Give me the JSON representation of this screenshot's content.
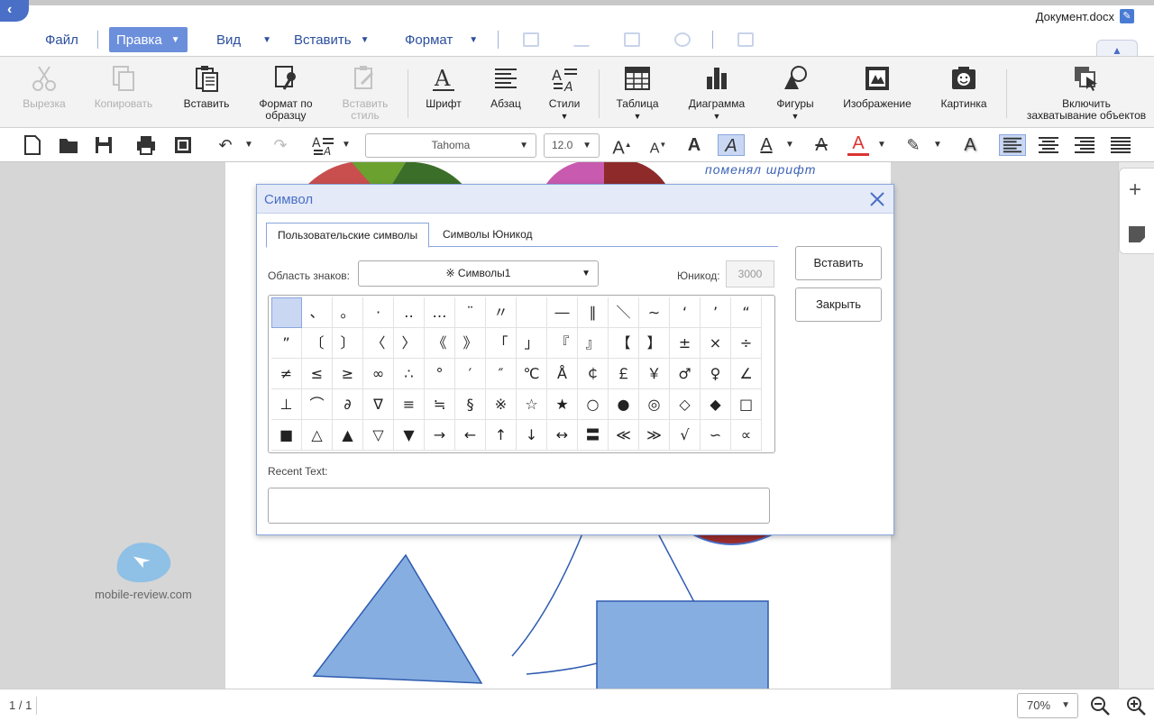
{
  "window": {
    "doc_name": "Документ.docx"
  },
  "menu": {
    "items": [
      {
        "label": "Файл"
      },
      {
        "label": "Правка"
      },
      {
        "label": "Вид"
      },
      {
        "label": "Вставить"
      },
      {
        "label": "Формат"
      }
    ]
  },
  "ribbon": {
    "cut": "Вырезка",
    "copy": "Копировать",
    "paste": "Вставить",
    "format_painter_1": "Формат по",
    "format_painter_2": "образцу",
    "paste_style_1": "Вставить",
    "paste_style_2": "стиль",
    "font": "Шрифт",
    "paragraph": "Абзац",
    "styles": "Стили",
    "table": "Таблица",
    "chart": "Диаграмма",
    "shapes": "Фигуры",
    "image": "Изображение",
    "picture": "Картинка",
    "capture_1": "Включить",
    "capture_2": "захватывание объектов"
  },
  "toolbar": {
    "font_name": "Tahoma",
    "font_size": "12.0"
  },
  "document": {
    "italic_text": "поменял шрифт"
  },
  "watermark": {
    "text": "mobile-review.com"
  },
  "status": {
    "page_count": "1 / 1",
    "zoom": "70%"
  },
  "dialog": {
    "title": "Символ",
    "tab_custom": "Пользовательские символы",
    "tab_unicode": "Символы Юникод",
    "area_label": "Область знаков:",
    "area_value": "※ Символы1",
    "unicode_label": "Юникод:",
    "unicode_value": "3000",
    "insert_button": "Вставить",
    "close_button": "Закрыть",
    "recent_label": "Recent Text:",
    "symbols": [
      [
        " ",
        "、",
        "。",
        "·",
        "‥",
        "…",
        "¨",
        "〃",
        "­",
        "―",
        "∥",
        "＼",
        "∼",
        "‘",
        "’",
        "“"
      ],
      [
        "”",
        "〔",
        "〕",
        "〈",
        "〉",
        "《",
        "》",
        "「",
        "」",
        "『",
        "』",
        "【",
        "】",
        "±",
        "×",
        "÷"
      ],
      [
        "≠",
        "≤",
        "≥",
        "∞",
        "∴",
        "°",
        "′",
        "″",
        "℃",
        "Å",
        "￠",
        "￡",
        "￥",
        "♂",
        "♀",
        "∠"
      ],
      [
        "⊥",
        "⌒",
        "∂",
        "∇",
        "≡",
        "≒",
        "§",
        "※",
        "☆",
        "★",
        "○",
        "●",
        "◎",
        "◇",
        "◆",
        "□"
      ],
      [
        "■",
        "△",
        "▲",
        "▽",
        "▼",
        "→",
        "←",
        "↑",
        "↓",
        "↔",
        "〓",
        "≪",
        "≫",
        "√",
        "∽",
        "∝"
      ]
    ]
  },
  "colors": {
    "accent": "#4a6fc7",
    "selected_menu": "#6c8fdc",
    "shape_fill": "#86aee0"
  }
}
